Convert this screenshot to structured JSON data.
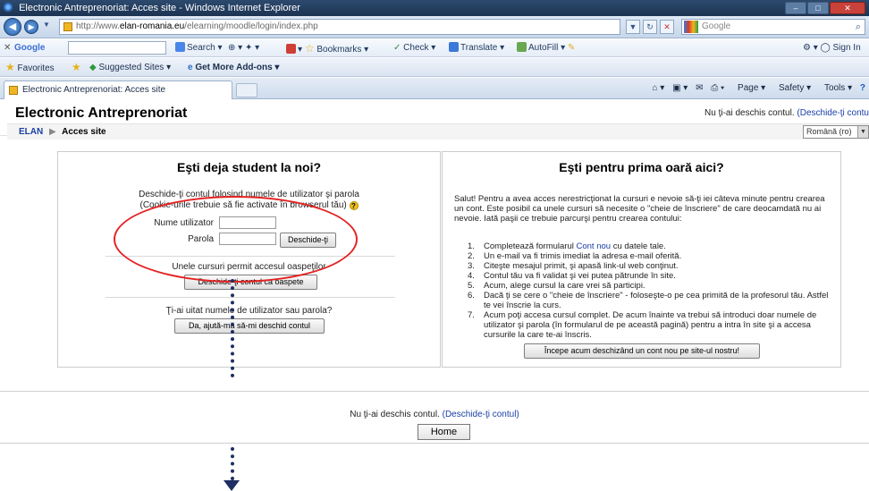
{
  "browser": {
    "window_title": "Electronic Antreprenoriat: Acces site - Windows Internet Explorer",
    "url_prefix": "http://www.",
    "url_domain": "elan-romania.eu",
    "url_path": "/elearning/moodle/login/index.php",
    "search_placeholder": "Google",
    "tab_title": "Electronic Antreprenoriat: Acces site",
    "google_bar": {
      "label": "Google",
      "search": "Search",
      "bookmarks": "Bookmarks",
      "check": "Check",
      "translate": "Translate",
      "autofill": "AutoFill",
      "sign_in": "Sign In"
    },
    "favorites": {
      "favorites_label": "Favorites",
      "suggested_sites": "Suggested Sites",
      "addons": "Get More Add-ons"
    },
    "command_bar": {
      "page": "Page",
      "safety": "Safety",
      "tools": "Tools"
    }
  },
  "site": {
    "title": "Electronic Antreprenoriat",
    "login_status": "Nu ţi-ai deschis contul.",
    "login_link": "(Deschide-ţi contu",
    "breadcrumb_home": "ELAN",
    "breadcrumb_sep": "▶",
    "breadcrumb_current": "Acces site",
    "language": "Română (ro)"
  },
  "login_panel": {
    "heading": "Eşti deja student la noi?",
    "intro_line1": "Deschide-ţi contul folosind numele de utilizator şi parola",
    "intro_line2": "(Cookie-urile trebuie să fie activate în browserul tău)",
    "username_label": "Nume utilizator",
    "username_value": "",
    "password_label": "Parola",
    "password_value": "",
    "login_button": "Deschide-ţi",
    "guest_text": "Unele cursuri permit accesul oaspeţilor",
    "guest_button": "Deschide-ţi contul ca oaspete",
    "forgot_text": "Ţi-ai uitat numele de utilizator sau parola?",
    "forgot_button": "Da, ajută-mă să-mi deschid contul"
  },
  "signup_panel": {
    "heading": "Eşti pentru prima oară aici?",
    "intro": "Salut! Pentru a avea acces nerestricţionat la cursuri e nevoie să-ţi iei câteva minute pentru crearea un cont. Este posibil ca unele cursuri să necesite o \"cheie de înscriere\" de care deocamdată nu ai nevoie. Iată paşii ce trebuie parcurşi pentru crearea contului:",
    "steps": [
      {
        "num": "1.",
        "text": "Completează formularul ",
        "link": "Cont nou",
        "after": " cu datele tale."
      },
      {
        "num": "2.",
        "text": "Un e-mail va fi trimis imediat la adresa e-mail oferită.",
        "link": "",
        "after": ""
      },
      {
        "num": "3.",
        "text": "Citeşte mesajul primit, şi apasă link-ul web conţinut.",
        "link": "",
        "after": ""
      },
      {
        "num": "4.",
        "text": "Contul tău va fi validat şi vei putea pătrunde în site.",
        "link": "",
        "after": ""
      },
      {
        "num": "5.",
        "text": "Acum, alege cursul la care vrei să participi.",
        "link": "",
        "after": ""
      },
      {
        "num": "6.",
        "text": "Dacă ţi se cere o \"cheie de înscriere\" - foloseşte-o pe cea primită de la profesorul tău. Astfel te vei înscrie la curs.",
        "link": "",
        "after": ""
      },
      {
        "num": "7.",
        "text": "Acum poţi accesa cursul complet. De acum înainte va trebui să introduci doar numele de utilizator şi parola (în formularul de pe această pagină) pentru a intra în site şi a accesa cursurile la care te-ai înscris.",
        "link": "",
        "after": ""
      }
    ],
    "signup_button": "Începe acum deschizând un cont nou pe site-ul nostru!"
  },
  "footer": {
    "status": "Nu ţi-ai deschis contul.",
    "link": "(Deschide-ţi contul)",
    "home_button": "Home"
  },
  "colors": {
    "annotation_ellipse": "#e42222",
    "annotation_arrow": "#1c2e63",
    "link": "#1b3ea8"
  }
}
